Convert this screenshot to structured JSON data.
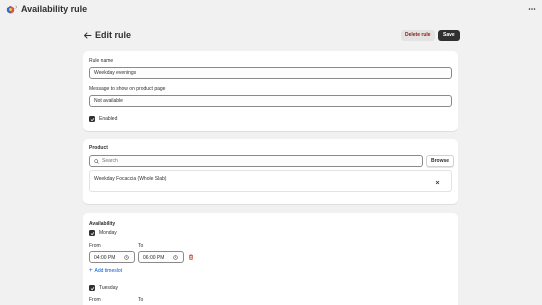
{
  "app": {
    "breadcrumb_separator": "›",
    "title": "Availability rule"
  },
  "header": {
    "title": "Edit rule",
    "delete_label": "Delete rule",
    "save_label": "Save"
  },
  "rule": {
    "name_label": "Rule name",
    "name_value": "Weekday evenings",
    "message_label": "Message to show on product page",
    "message_value": "Not available",
    "enabled_label": "Enabled",
    "enabled": true
  },
  "product": {
    "heading": "Product",
    "search_placeholder": "Search",
    "browse_label": "Browse",
    "selected": [
      {
        "name": "Weekday Focaccia (Whole Slab)"
      }
    ]
  },
  "availability": {
    "heading": "Availability",
    "days": [
      {
        "name": "Monday",
        "checked": true,
        "from_label": "From",
        "to_label": "To",
        "from": "04:00 PM",
        "to": "06:00 PM",
        "add_label": "Add timeslot"
      },
      {
        "name": "Tuesday",
        "checked": true,
        "from_label": "From",
        "to_label": "To"
      }
    ]
  },
  "colors": {
    "background": "#f1f1f1",
    "primary_button": "#303030",
    "critical_text": "#8e1f0b",
    "link": "#005bd3",
    "delete_icon": "#c5280c"
  }
}
